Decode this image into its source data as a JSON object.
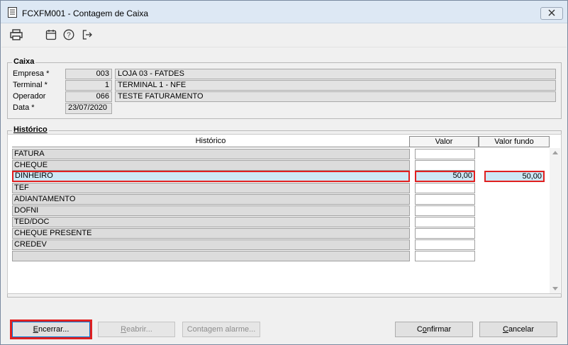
{
  "window": {
    "title": "FCXFM001 - Contagem de Caixa"
  },
  "toolbar": {
    "icons": [
      "printer-icon",
      "calendar-icon",
      "help-icon",
      "exit-icon"
    ]
  },
  "caixa": {
    "legend": "Caixa",
    "empresa_label": "Empresa *",
    "empresa_code": "003",
    "empresa_name": "LOJA 03 - FATDES",
    "terminal_label": "Terminal *",
    "terminal_code": "1",
    "terminal_name": "TERMINAL 1 - NFE",
    "operador_label": "Operador",
    "operador_code": "066",
    "operador_name": "TESTE FATURAMENTO",
    "data_label": "Data *",
    "data_value": "23/07/2020"
  },
  "historico": {
    "legend": "Histórico",
    "columns": {
      "historico": "Histórico",
      "valor": "Valor",
      "valor_fundo": "Valor fundo"
    },
    "rows": [
      {
        "historico": "FATURA",
        "valor": ""
      },
      {
        "historico": "CHEQUE",
        "valor": ""
      },
      {
        "historico": "DINHEIRO",
        "valor": "50,00",
        "valor_fundo": "50,00"
      },
      {
        "historico": "TEF",
        "valor": ""
      },
      {
        "historico": "ADIANTAMENTO",
        "valor": ""
      },
      {
        "historico": "DOFNI",
        "valor": ""
      },
      {
        "historico": "TED/DOC",
        "valor": ""
      },
      {
        "historico": "CHEQUE PRESENTE",
        "valor": ""
      },
      {
        "historico": "CREDEV",
        "valor": ""
      },
      {
        "historico": "",
        "valor": ""
      }
    ]
  },
  "buttons": {
    "encerrar": {
      "prefix": "",
      "hot": "E",
      "rest": "ncerrar..."
    },
    "reabrir": {
      "prefix": "",
      "hot": "R",
      "rest": "eabrir..."
    },
    "contagem_alarme": {
      "prefix": "Contagem alarme...",
      "hot": "",
      "rest": ""
    },
    "confirmar": {
      "prefix": "C",
      "hot": "o",
      "rest": "nfirmar"
    },
    "cancelar": {
      "prefix": "",
      "hot": "C",
      "rest": "ancelar"
    }
  },
  "colors": {
    "selection": "#cde8f5",
    "highlight_border": "#e02020",
    "titlebar": "#dde8f4"
  }
}
